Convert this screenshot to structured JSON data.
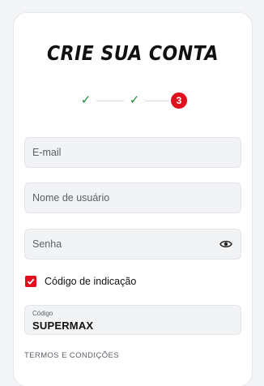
{
  "form": {
    "title": "CRIE SUA CONTA",
    "stepper": {
      "completed_steps": 2,
      "current_step": "3"
    },
    "email": {
      "placeholder": "E-mail",
      "value": ""
    },
    "username": {
      "placeholder": "Nome de usuário",
      "value": ""
    },
    "password": {
      "placeholder": "Senha",
      "value": "",
      "toggle_icon": "eye-icon"
    },
    "referral": {
      "checked": true,
      "label": "Código de indicação"
    },
    "code": {
      "label": "Código",
      "value": "SUPERMAX"
    },
    "terms_heading": "TERMOS E CONDIÇÕES"
  },
  "colors": {
    "accent": "#e0101e",
    "success": "#1f8b3a",
    "field_bg": "#f2f3f5"
  }
}
